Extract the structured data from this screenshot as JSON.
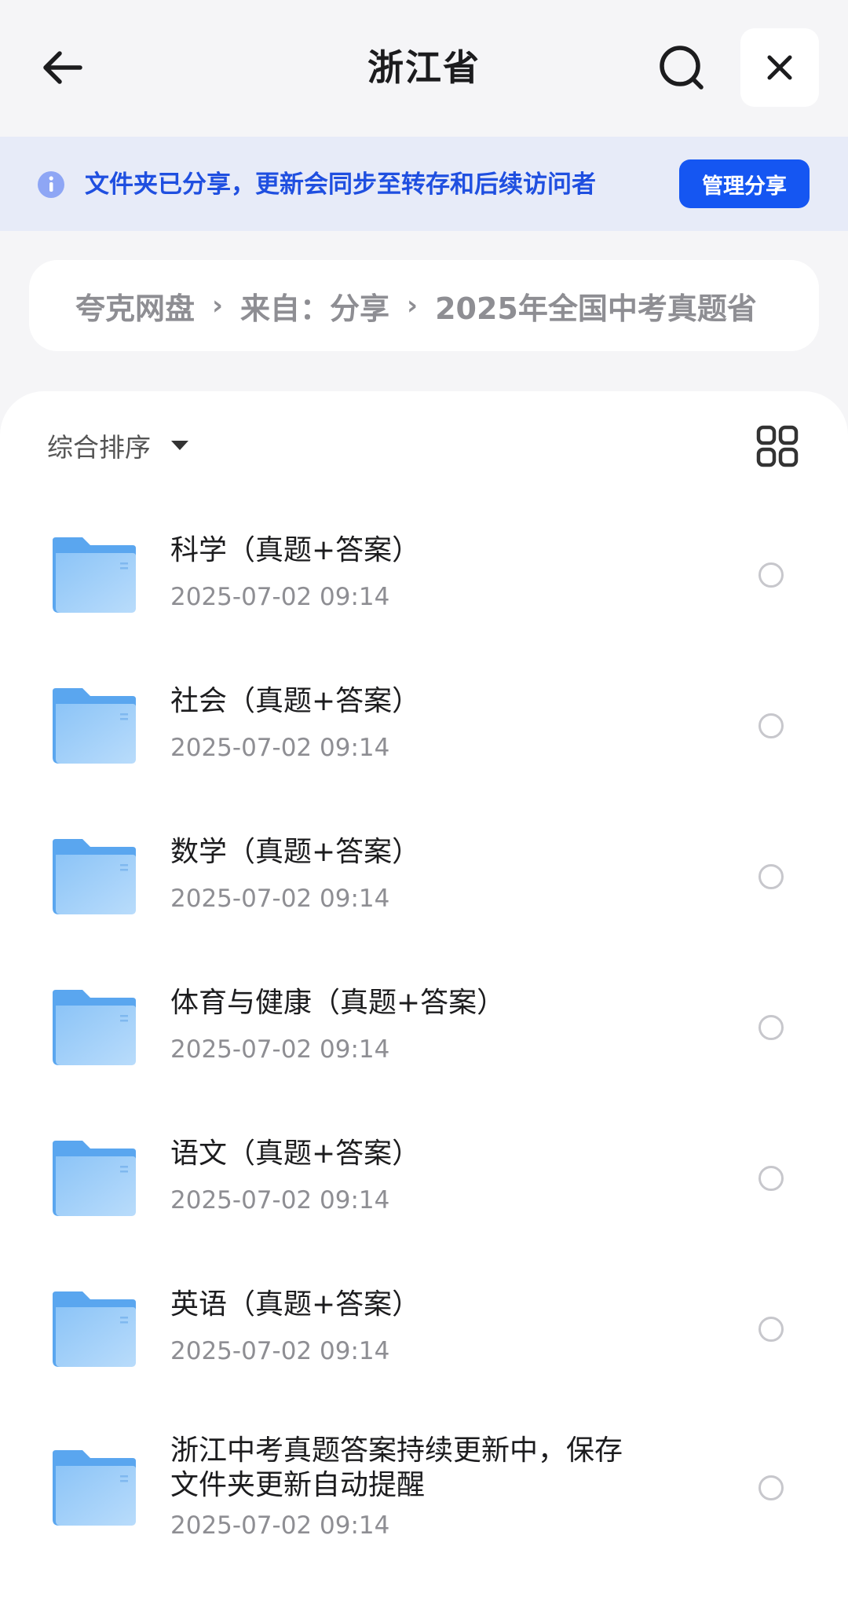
{
  "header": {
    "title": "浙江省",
    "back_icon": "back-arrow-icon",
    "search_icon": "search-icon",
    "close_icon": "close-icon"
  },
  "notice": {
    "icon": "info-icon",
    "text": "文件夹已分享，更新会同步至转存和后续访问者",
    "button_label": "管理分享",
    "accent_color": "#1556f2"
  },
  "breadcrumb": {
    "items": [
      "夸克网盘",
      "来自：分享",
      "2025年全国中考真题省"
    ]
  },
  "toolbar": {
    "sort_label": "综合排序",
    "view_toggle_icon": "grid-view-icon"
  },
  "files": [
    {
      "name": "科学（真题+答案）",
      "date": "2025-07-02 09:14"
    },
    {
      "name": "社会（真题+答案）",
      "date": "2025-07-02 09:14"
    },
    {
      "name": "数学（真题+答案）",
      "date": "2025-07-02 09:14"
    },
    {
      "name": "体育与健康（真题+答案）",
      "date": "2025-07-02 09:14"
    },
    {
      "name": "语文（真题+答案）",
      "date": "2025-07-02 09:14"
    },
    {
      "name": "英语（真题+答案）",
      "date": "2025-07-02 09:14"
    },
    {
      "name_line1": "浙江中考真题答案持续更新中，保存",
      "name_line2": "文件夹更新自动提醒",
      "date": "2025-07-02 09:14"
    }
  ]
}
